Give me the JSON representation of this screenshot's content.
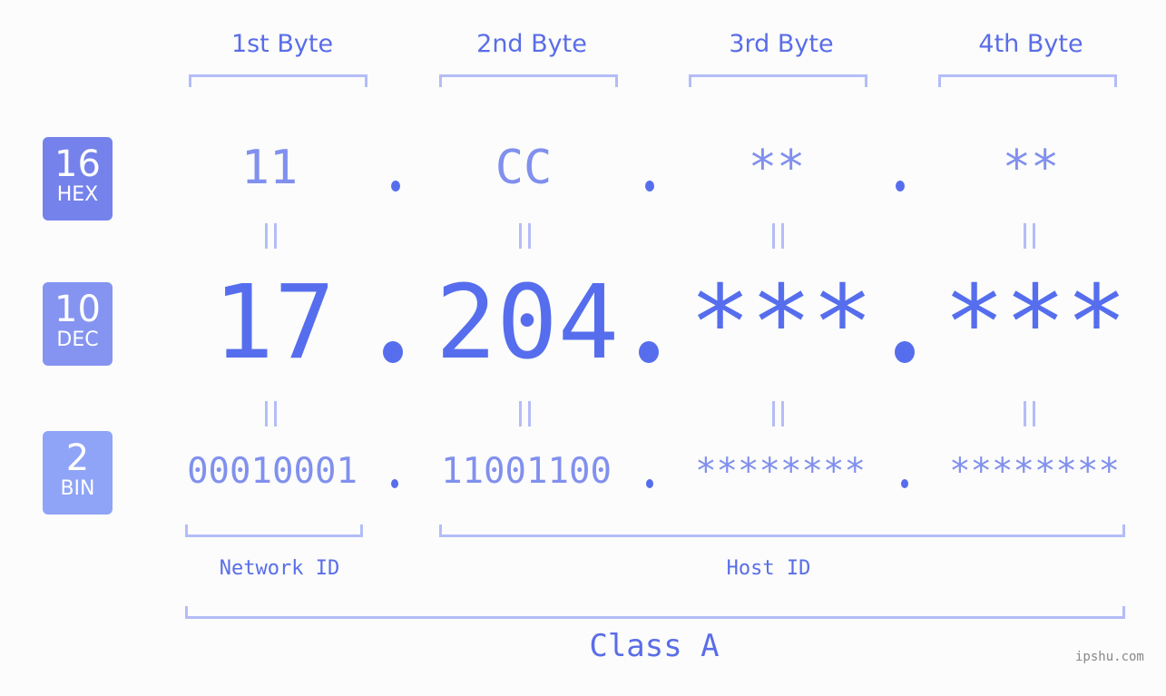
{
  "byte_headers": [
    "1st Byte",
    "2nd Byte",
    "3rd Byte",
    "4th Byte"
  ],
  "bases": [
    {
      "number": "16",
      "label": "HEX",
      "color": "#7582ec"
    },
    {
      "number": "10",
      "label": "DEC",
      "color": "#8594f0"
    },
    {
      "number": "2",
      "label": "BIN",
      "color": "#8fa4f7"
    }
  ],
  "hex": [
    "11",
    "CC",
    "**",
    "**"
  ],
  "dec": [
    "17",
    "204",
    "***",
    "***"
  ],
  "bin": [
    "00010001",
    "11001100",
    "********",
    "********"
  ],
  "equals_symbol": "=",
  "network_id_label": "Network ID",
  "host_id_label": "Host ID",
  "class_label": "Class A",
  "watermark": "ipshu.com",
  "colors": {
    "primary": "#566eed",
    "secondary": "#8190ee",
    "bracket": "#b4bdf7"
  }
}
